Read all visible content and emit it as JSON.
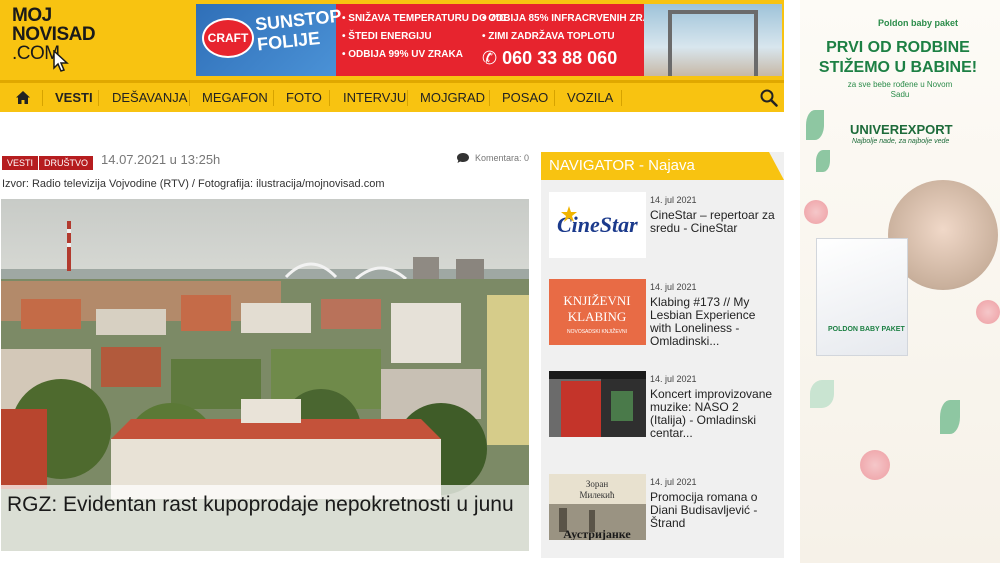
{
  "logo": {
    "line1": "MOJ",
    "line2": "NOVISAD",
    "line3": ".COM"
  },
  "banner": {
    "brand": "CRAFT",
    "product_line1": "SUNSTOP",
    "product_line2": "FOLIJE",
    "features_left": [
      "• SNIŽAVA TEMPERATURU DO 7°C",
      "• ŠTEDI ENERGIJU",
      "• ODBIJA 99% UV ZRAKA"
    ],
    "features_right": [
      "• ODBIJA 85% INFRACRVENIH ZRAKA",
      "• ZIMI ZADRŽAVA TOPLOTU"
    ],
    "phone": "060 33 88 060"
  },
  "nav": {
    "items": [
      "VESTI",
      "DEŠAVANJA",
      "MEGAFON",
      "FOTO",
      "INTERVJU",
      "MOJGRAD",
      "POSAO",
      "VOZILA"
    ],
    "active": "VESTI"
  },
  "article": {
    "categories": [
      "VESTI",
      "DRUŠTVO"
    ],
    "date": "14.07.2021 u 13:25h",
    "comments": "Komentara: 0",
    "source": "Izvor: Radio televizija Vojvodine (RTV) / Fotografija: ilustracija/mojnovisad.com",
    "title": "RGZ: Evidentan rast kupoprodaje nepokretnosti u junu"
  },
  "navigator": {
    "title": "NAVIGATOR - Najava",
    "items": [
      {
        "date": "14. jul 2021",
        "text": "CineStar – repertoar za sredu - CineStar",
        "thumb_text": "CineStar"
      },
      {
        "date": "14. jul 2021",
        "text": "Klabing #173 // My Lesbian Experience with Loneliness - Omladinski...",
        "thumb_text_1": "KNJIŽEVNI",
        "thumb_text_2": "KLABING",
        "thumb_text_3": "NOVOSADSKI KNJIŽEVNI"
      },
      {
        "date": "14. jul 2021",
        "text": "Koncert improvizovane muzike: NASO 2 (Italija) - Omladinski centar..."
      },
      {
        "date": "14. jul 2021",
        "text": "Promocija romana o Diani Budisavljević - Štrand",
        "thumb_text_1": "Зоран",
        "thumb_text_2": "Милекић",
        "thumb_text_3": "Аустријанке"
      }
    ]
  },
  "side_ad": {
    "brand": "Poldon baby paket",
    "headline_1": "PRVI OD RODBINE",
    "headline_2": "STIŽEMO U BABINE!",
    "sub": "za sve bebe rođene u Novom Sadu",
    "retailer": "UNIVEREXPORT",
    "retailer_sub": "Najbolje nade, za najbolje vede",
    "box_label": "POLDON BABY PAKET"
  },
  "colors": {
    "accent": "#f8c311",
    "category_red": "#b61d1f",
    "navigator_head": "#f8c311"
  }
}
